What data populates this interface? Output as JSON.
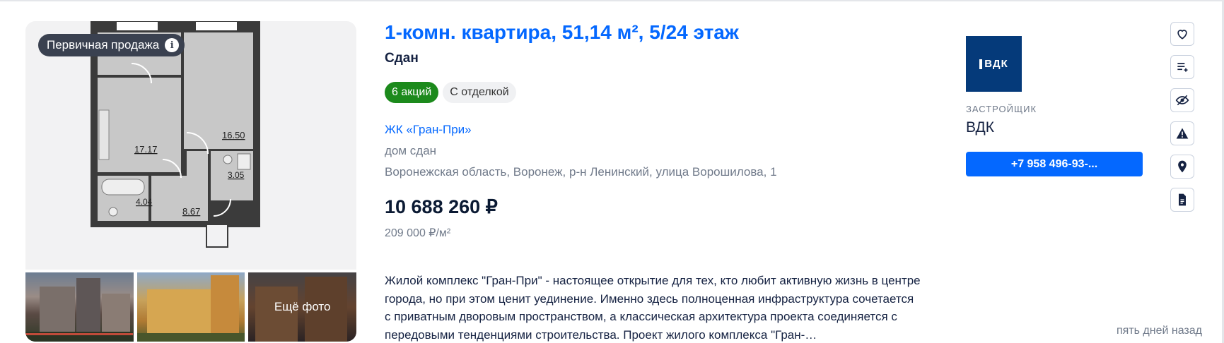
{
  "listing": {
    "badge": "Первичная продажа",
    "title": "1-комн. квартира, 51,14 м², 5/24 этаж",
    "status": "Сдан",
    "tags": [
      "6 акций",
      "С отделкой"
    ],
    "complex": "ЖК «Гран-При»",
    "house_status": "дом сдан",
    "address": "Воронежская область, Воронеж, р-н Ленинский, улица Ворошилова, 1",
    "price": "10 688 260 ₽",
    "price_per_m2": "209 000 ₽/м²",
    "description": "Жилой комплекс \"Гран-При\" - настоящее открытие для тех, кто любит активную жизнь в центре города, но при этом ценит уединение. Именно здесь полноценная инфраструктура сочетается с приватным дворовым пространством, а классическая архитектура проекта соединяется с передовыми тенденциями строительства. Проект жилого комплекса \"Гран-…",
    "date": "пять дней назад"
  },
  "floorplan": {
    "rooms": [
      "17.17",
      "16.50",
      "3.05",
      "4.04",
      "8.67"
    ]
  },
  "gallery": {
    "more_label": "Ещё фото"
  },
  "developer": {
    "logo_text": "ВДК",
    "caption": "ЗАСТРОЙЩИК",
    "name": "ВДК",
    "phone": "+7 958 496-93-..."
  },
  "colors": {
    "accent": "#0468ff",
    "promo_green": "#1c8a1c",
    "developer_blue": "#053a7a"
  },
  "icons": [
    "heart-icon",
    "add-to-list-icon",
    "hide-icon",
    "warning-icon",
    "location-pin-icon",
    "document-icon"
  ]
}
